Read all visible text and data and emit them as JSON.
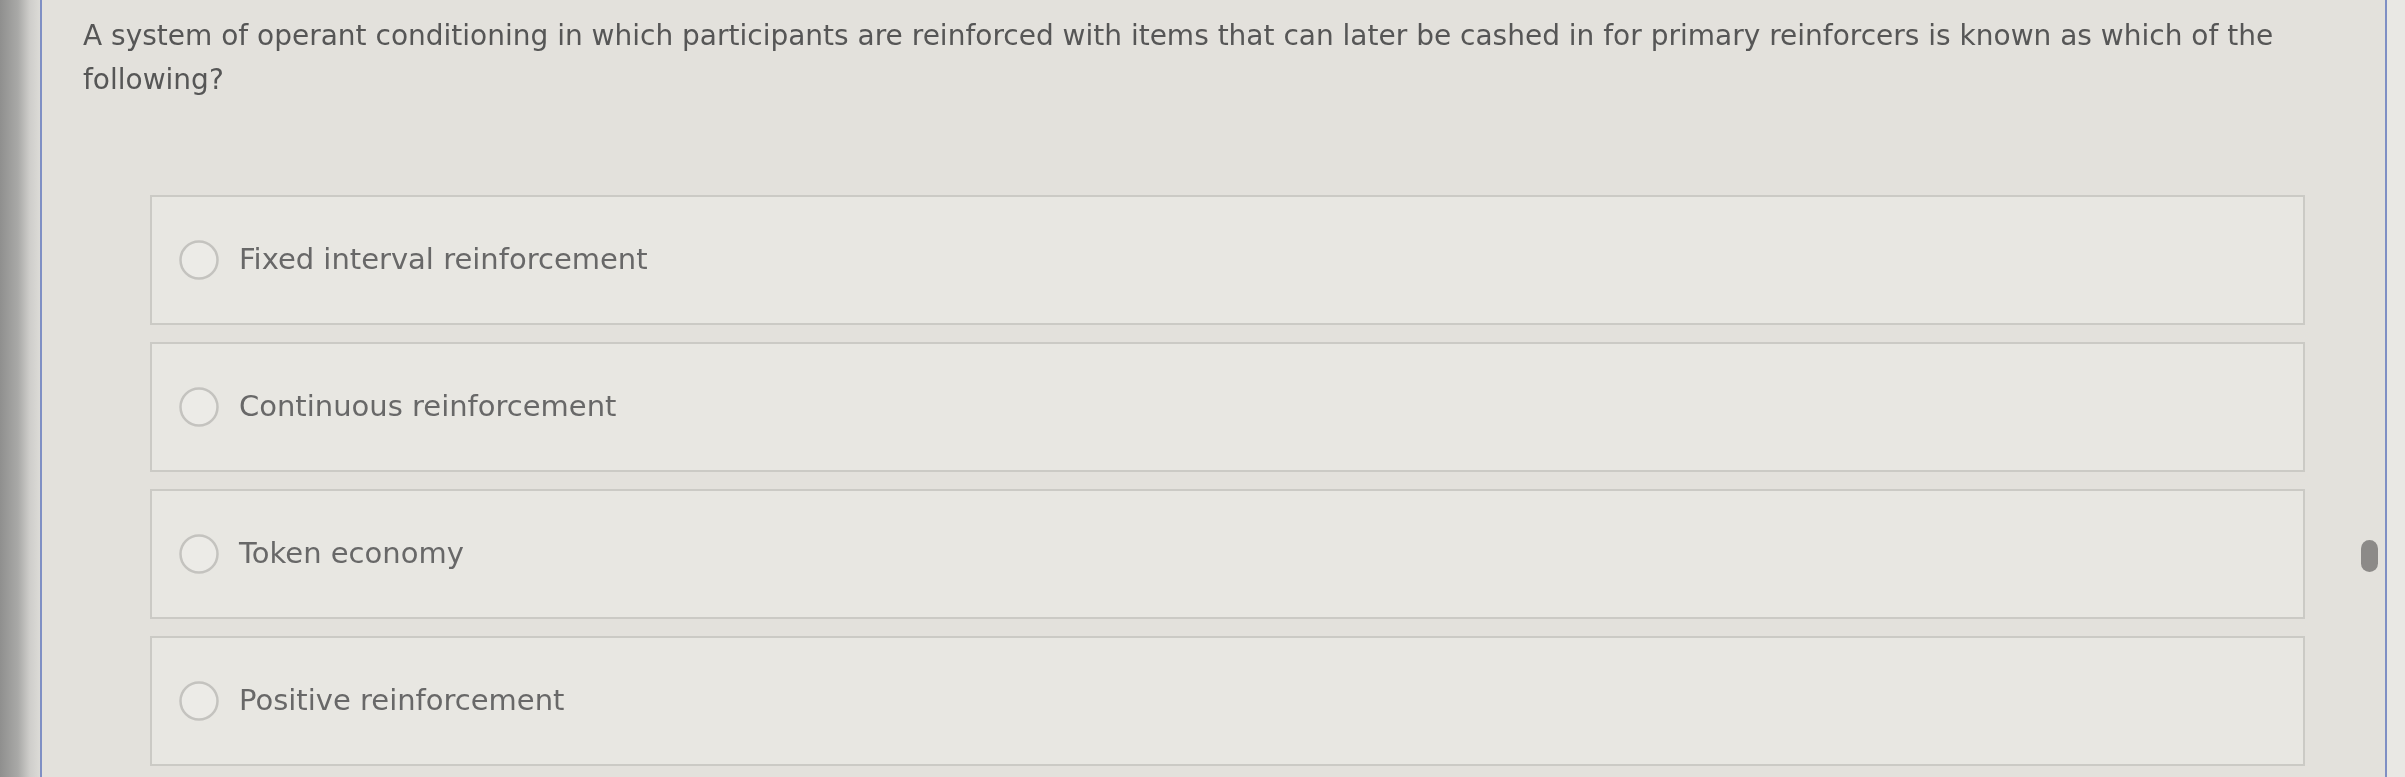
{
  "question": "A system of operant conditioning in which participants are reinforced with items that can later be cashed in for primary reinforcers is known as which of the following?",
  "options": [
    {
      "label": "Fixed interval reinforcement",
      "selected": false
    },
    {
      "label": "Continuous reinforcement",
      "selected": false
    },
    {
      "label": "Token economy",
      "selected": false
    },
    {
      "label": "Positive reinforcement",
      "selected": false
    }
  ]
}
